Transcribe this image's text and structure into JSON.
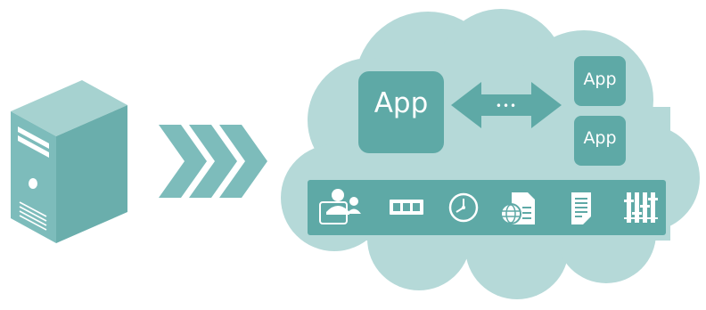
{
  "colors": {
    "server": "#7dbcbb",
    "server_front": "#76b7b5",
    "server_side": "#5d9e9c",
    "cloud": "#b5d9d8",
    "app_box": "#5ea9a6",
    "toolbar": "#5ea9a6",
    "arrow": "#5ea9a6",
    "chevrons": "#7dbcbb",
    "icon": "#ffffff"
  },
  "apps": {
    "large": "App",
    "small_top": "App",
    "small_bottom": "App"
  },
  "connector": {
    "dots": "•••"
  },
  "toolbar_icons": [
    "users-icon",
    "memory-icon",
    "clock-icon",
    "web-document-icon",
    "document-icon",
    "sliders-icon"
  ]
}
